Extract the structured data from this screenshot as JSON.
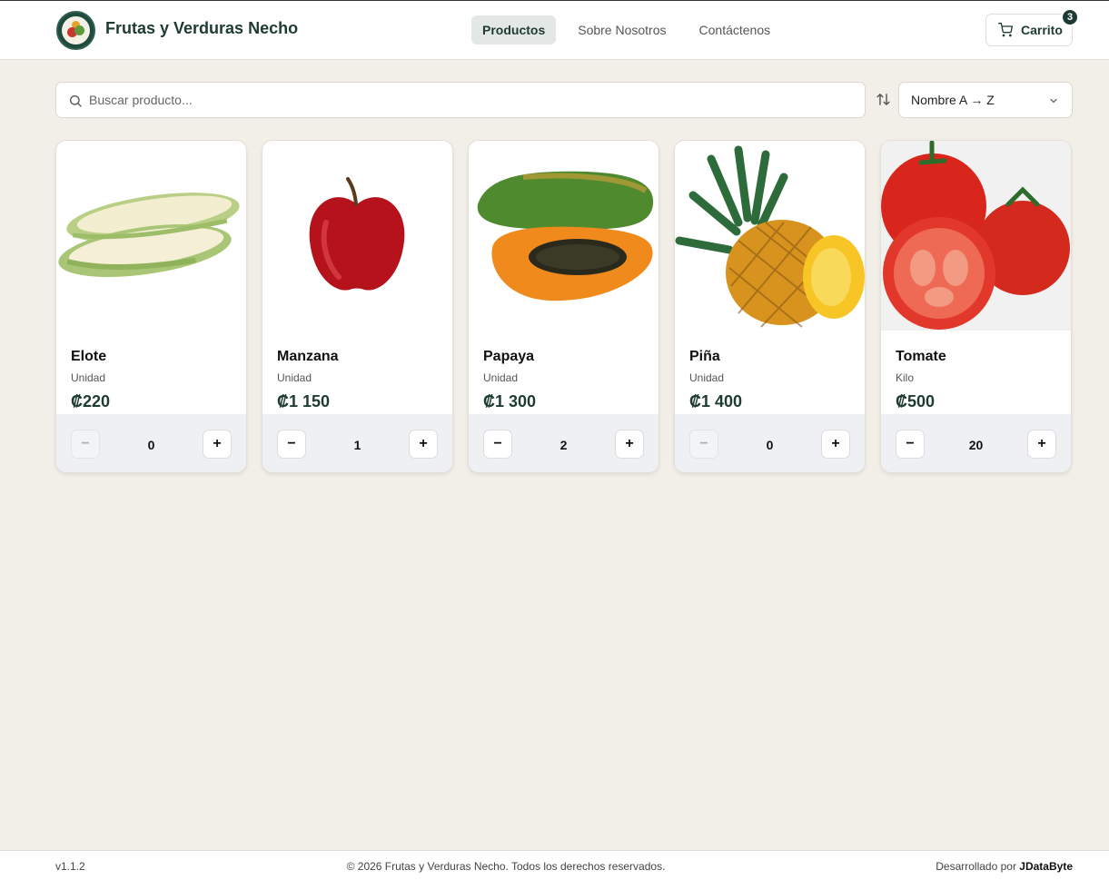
{
  "header": {
    "brand": "Frutas y Verduras Necho",
    "nav": [
      "Productos",
      "Sobre Nosotros",
      "Contáctenos"
    ],
    "active_nav": "Productos",
    "cart_label": "Carrito",
    "cart_count": "3"
  },
  "toolbar": {
    "search_placeholder": "Buscar producto...",
    "sort_value": "Nombre A → Z"
  },
  "products": [
    {
      "name": "Elote",
      "unit": "Unidad",
      "price": "₡220",
      "qty": "0",
      "minus": "−",
      "plus": "+"
    },
    {
      "name": "Manzana",
      "unit": "Unidad",
      "price": "₡1 150",
      "qty": "1",
      "minus": "−",
      "plus": "+"
    },
    {
      "name": "Papaya",
      "unit": "Unidad",
      "price": "₡1 300",
      "qty": "2",
      "minus": "−",
      "plus": "+"
    },
    {
      "name": "Piña",
      "unit": "Unidad",
      "price": "₡1 400",
      "qty": "0",
      "minus": "−",
      "plus": "+"
    },
    {
      "name": "Tomate",
      "unit": "Kilo",
      "price": "₡500",
      "qty": "20",
      "minus": "−",
      "plus": "+"
    }
  ],
  "icons": {
    "search": "search-icon",
    "sort": "sort-arrows-icon",
    "dropdown": "chevron-down-icon",
    "cart": "shopping-cart-icon"
  },
  "footer": {
    "version": "v1.1.2",
    "copyright": "© 2026 Frutas y Verduras Necho. Todos los derechos reservados.",
    "developed_by_prefix": "Desarrollado por",
    "developer": "JDataByte"
  },
  "colors": {
    "brand": "#1d3b33",
    "background": "#f2efe9"
  }
}
